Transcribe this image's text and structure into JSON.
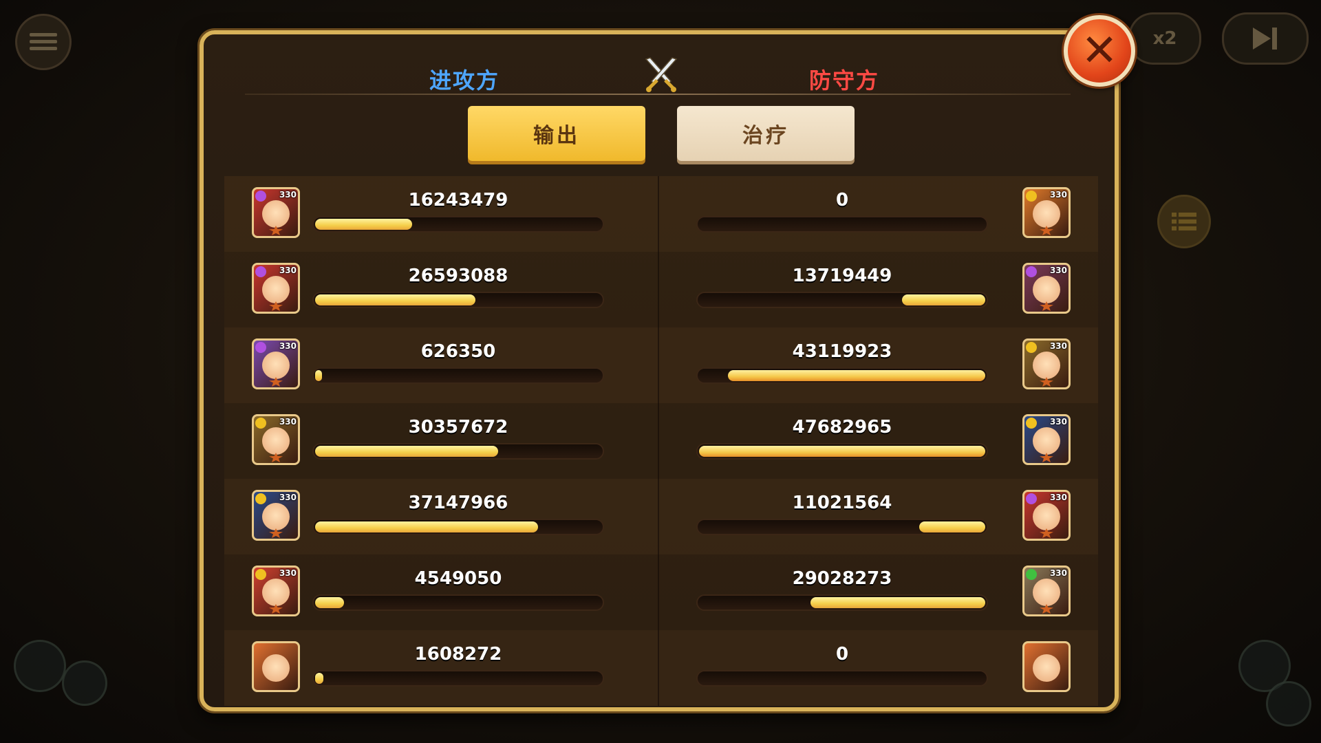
{
  "background": {
    "speed_label": "x2"
  },
  "header": {
    "attacker_title": "进攻方",
    "defender_title": "防守方"
  },
  "tabs": {
    "output_label": "输出",
    "heal_label": "治疗"
  },
  "rows": [
    {
      "attacker": {
        "level": "330",
        "value": "16243479",
        "fill": 0.34,
        "color": "#c8362e",
        "faction": "#b050e0"
      },
      "defender": {
        "level": "330",
        "value": "0",
        "fill": 0.0,
        "color": "#e07a2a",
        "faction": "#f0c020"
      }
    },
    {
      "attacker": {
        "level": "330",
        "value": "26593088",
        "fill": 0.56,
        "color": "#c8362e",
        "faction": "#b050e0"
      },
      "defender": {
        "level": "330",
        "value": "13719449",
        "fill": 0.29,
        "color": "#7a3a5a",
        "faction": "#b050e0"
      }
    },
    {
      "attacker": {
        "level": "330",
        "value": "626350",
        "fill": 0.01,
        "color": "#7a4ab0",
        "faction": "#b050e0"
      },
      "defender": {
        "level": "330",
        "value": "43119923",
        "fill": 0.9,
        "color": "#8a6a2a",
        "faction": "#f0c020"
      }
    },
    {
      "attacker": {
        "level": "330",
        "value": "30357672",
        "fill": 0.64,
        "color": "#8a6a2a",
        "faction": "#f0c020"
      },
      "defender": {
        "level": "330",
        "value": "47682965",
        "fill": 1.0,
        "color": "#2a4a8a",
        "faction": "#f0c020"
      }
    },
    {
      "attacker": {
        "level": "330",
        "value": "37147966",
        "fill": 0.78,
        "color": "#2a4a8a",
        "faction": "#f0c020"
      },
      "defender": {
        "level": "330",
        "value": "11021564",
        "fill": 0.23,
        "color": "#c8362e",
        "faction": "#b050e0"
      }
    },
    {
      "attacker": {
        "level": "330",
        "value": "4549050",
        "fill": 0.1,
        "color": "#d04030",
        "faction": "#f0c020"
      },
      "defender": {
        "level": "330",
        "value": "29028273",
        "fill": 0.61,
        "color": "#8a7a5a",
        "faction": "#40c040"
      }
    },
    {
      "attacker": {
        "level": "",
        "value": "1608272",
        "fill": 0.03,
        "color": "#e07030",
        "faction": ""
      },
      "defender": {
        "level": "",
        "value": "0",
        "fill": 0.0,
        "color": "#e07030",
        "faction": ""
      }
    }
  ]
}
